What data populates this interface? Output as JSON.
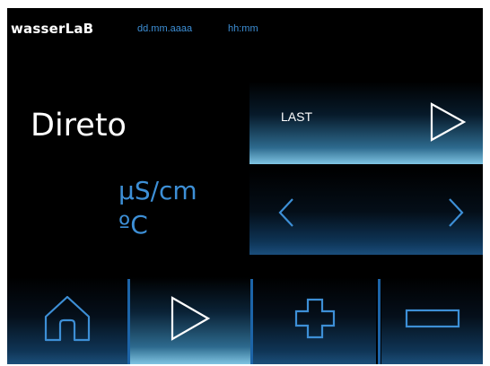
{
  "header": {
    "brand": "wasserLaB",
    "date_placeholder": "dd.mm.aaaa",
    "time_placeholder": "hh:mm"
  },
  "main": {
    "mode_title": "Direto",
    "unit_conductivity": "µS/cm",
    "unit_temperature": "ºC"
  },
  "last_panel": {
    "label": "LAST",
    "icon": "play-icon"
  },
  "nav_panel": {
    "prev_icon": "chevron-left-icon",
    "next_icon": "chevron-right-icon"
  },
  "tabs": [
    {
      "icon": "home-icon",
      "active": false
    },
    {
      "icon": "play-icon",
      "active": true
    },
    {
      "icon": "plus-icon",
      "active": false
    },
    {
      "icon": "minus-icon",
      "active": false
    }
  ],
  "colors": {
    "accent": "#3d8fd6",
    "separator": "#1c64a8",
    "active_highlight": "#7fc4e2",
    "background": "#000000"
  }
}
